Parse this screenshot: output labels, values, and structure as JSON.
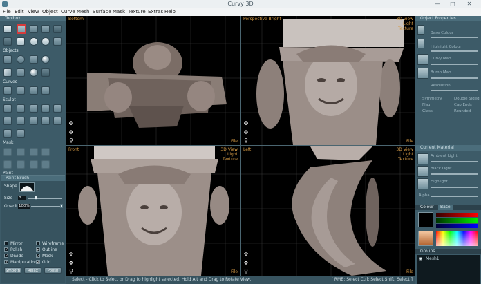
{
  "window": {
    "title": "Curvy 3D",
    "minimize": "—",
    "maximize": "□",
    "close": "✕"
  },
  "menu": [
    "File",
    "Edit",
    "View",
    "Object",
    "Curve",
    "Mesh",
    "Surface",
    "Mask",
    "Texture",
    "Extras",
    "Help"
  ],
  "toolbox": {
    "title": "Toolbox",
    "sections": {
      "objects": "Objects",
      "curves": "Curves",
      "sculpt": "Sculpt",
      "mask": "Mask",
      "paint": "Paint"
    }
  },
  "paint_brush": {
    "title": "Paint Brush",
    "shape_label": "Shape",
    "size_label": "Size",
    "size_value": "8",
    "opacity_label": "Opacity",
    "opacity_value": "100%",
    "options": [
      {
        "label": "Mirror",
        "checked": false
      },
      {
        "label": "Wireframe",
        "checked": false
      },
      {
        "label": "Polish",
        "checked": true
      },
      {
        "label": "Outline",
        "checked": true
      },
      {
        "label": "Divide",
        "checked": true
      },
      {
        "label": "Mask",
        "checked": true
      },
      {
        "label": "Manipulation",
        "checked": true
      },
      {
        "label": "Grid",
        "checked": true
      }
    ],
    "buttons": [
      "Smooth",
      "Relax",
      "Polish"
    ]
  },
  "viewports": [
    {
      "name": "Bottom",
      "options": [],
      "file": "File"
    },
    {
      "name": "Perspective Bright",
      "options": [
        "3D View",
        "Light",
        "Texture"
      ],
      "file": "File"
    },
    {
      "name": "Front",
      "options": [
        "3D View",
        "Light",
        "Texture"
      ],
      "file": "File"
    },
    {
      "name": "Left",
      "options": [
        "3D View",
        "Light",
        "Texture"
      ],
      "file": "File"
    }
  ],
  "viewport_nav_icons": [
    "orbit-icon",
    "pan-icon",
    "zoom-icon"
  ],
  "status": {
    "hint": "Select - Click to Select or Drag to highlight selected. Hold Alt and Drag to Rotate View.",
    "keys": "[ RMB: Select   Ctrl: Select   Shift: Select ]"
  },
  "object_properties": {
    "title": "Object Properties",
    "items": [
      "Base Colour",
      "Highlight Colour",
      "Curvy Map",
      "Bump Map"
    ],
    "resolution_label": "Resolution",
    "options": [
      "Symmetry",
      "Double Sided",
      "Flag",
      "Cap Ends",
      "Glass",
      "Rounded"
    ]
  },
  "current_material": {
    "title": "Current Material",
    "items": [
      "Ambient Light",
      "Black Light",
      "Highlight"
    ],
    "alpha_label": "Alpha"
  },
  "colour": {
    "tabs": [
      "Colour",
      "Base"
    ]
  },
  "groups": {
    "title": "Groups",
    "items": [
      "Mesh1"
    ]
  }
}
